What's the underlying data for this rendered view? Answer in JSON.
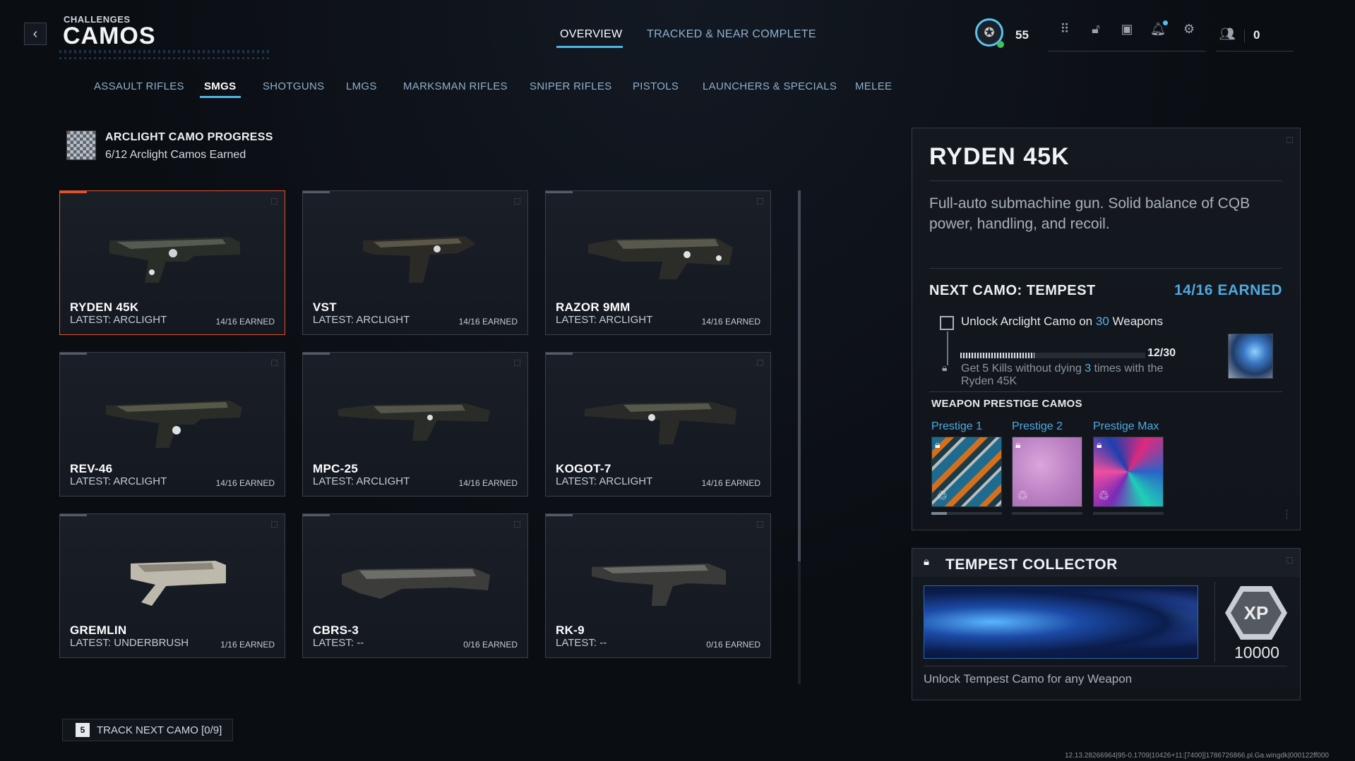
{
  "header": {
    "eyebrow": "CHALLENGES",
    "title": "CAMOS",
    "tabs": [
      "OVERVIEW",
      "TRACKED & NEAR COMPLETE"
    ],
    "level": "55",
    "social_count": "0"
  },
  "categories": [
    "ASSAULT RIFLES",
    "SMGS",
    "SHOTGUNS",
    "LMGS",
    "MARKSMAN RIFLES",
    "SNIPER RIFLES",
    "PISTOLS",
    "LAUNCHERS & SPECIALS",
    "MELEE"
  ],
  "active_category": "SMGS",
  "progress": {
    "title": "ARCLIGHT CAMO PROGRESS",
    "subtitle": "6/12 Arclight Camos Earned"
  },
  "weapons": [
    {
      "name": "RYDEN 45K",
      "latest": "LATEST: ARCLIGHT",
      "earned": "14/16 EARNED"
    },
    {
      "name": "VST",
      "latest": "LATEST: ARCLIGHT",
      "earned": "14/16 EARNED"
    },
    {
      "name": "RAZOR 9MM",
      "latest": "LATEST: ARCLIGHT",
      "earned": "14/16 EARNED"
    },
    {
      "name": "REV-46",
      "latest": "LATEST: ARCLIGHT",
      "earned": "14/16 EARNED"
    },
    {
      "name": "MPC-25",
      "latest": "LATEST: ARCLIGHT",
      "earned": "14/16 EARNED"
    },
    {
      "name": "KOGOT-7",
      "latest": "LATEST: ARCLIGHT",
      "earned": "14/16 EARNED"
    },
    {
      "name": "GREMLIN",
      "latest": "LATEST: UNDERBRUSH",
      "earned": "1/16 EARNED"
    },
    {
      "name": "CBRS-3",
      "latest": "LATEST: --",
      "earned": "0/16 EARNED"
    },
    {
      "name": "RK-9",
      "latest": "LATEST: --",
      "earned": "0/16 EARNED"
    }
  ],
  "track": {
    "key": "5",
    "label": "TRACK NEXT CAMO [0/9]"
  },
  "detail": {
    "title": "RYDEN 45K",
    "description": "Full-auto submachine gun. Solid balance of CQB power, handling, and recoil.",
    "next_camo": "NEXT CAMO: TEMPEST",
    "next_earned": "14/16 EARNED",
    "task_prefix": "Unlock Arclight Camo on ",
    "task_count": "30",
    "task_suffix": " Weapons",
    "progress_value": "12/30",
    "progress_fraction": 0.4,
    "sub_prefix": "Get 5 Kills without dying ",
    "sub_count": "3",
    "sub_suffix": " times with the Ryden 45K",
    "prestige_header": "WEAPON PRESTIGE CAMOS",
    "prestige": [
      "Prestige 1",
      "Prestige 2",
      "Prestige Max"
    ]
  },
  "collector": {
    "title": "TEMPEST COLLECTOR",
    "xp_badge": "XP",
    "xp_value": "10000",
    "description": "Unlock Tempest Camo for any Weapon"
  },
  "build": "12.13.28266964|95-0.1709|10426+11:[7400]|1786726866.pl.Ga.wingdk|000122ff000",
  "colors": {
    "accent": "#4fb5e6",
    "selected": "#e0532f",
    "earned": "#4fa9e0"
  }
}
